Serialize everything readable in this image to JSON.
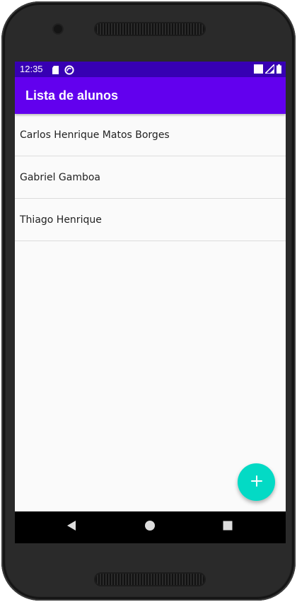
{
  "status_bar": {
    "time": "12:35",
    "icons_left": [
      "sd-card-icon",
      "sync-circle-icon"
    ],
    "icons_right": [
      "square-icon",
      "signal-icon",
      "battery-icon"
    ],
    "color": "#3700b3"
  },
  "app_bar": {
    "title": "Lista de alunos",
    "color": "#6200ee"
  },
  "students": [
    {
      "name": "Carlos Henrique Matos Borges"
    },
    {
      "name": "Gabriel Gamboa"
    },
    {
      "name": "Thiago Henrique"
    }
  ],
  "fab": {
    "icon": "plus-icon",
    "color": "#03dac5"
  },
  "nav_bar": {
    "buttons": [
      "back-icon",
      "home-icon",
      "recents-icon"
    ]
  }
}
